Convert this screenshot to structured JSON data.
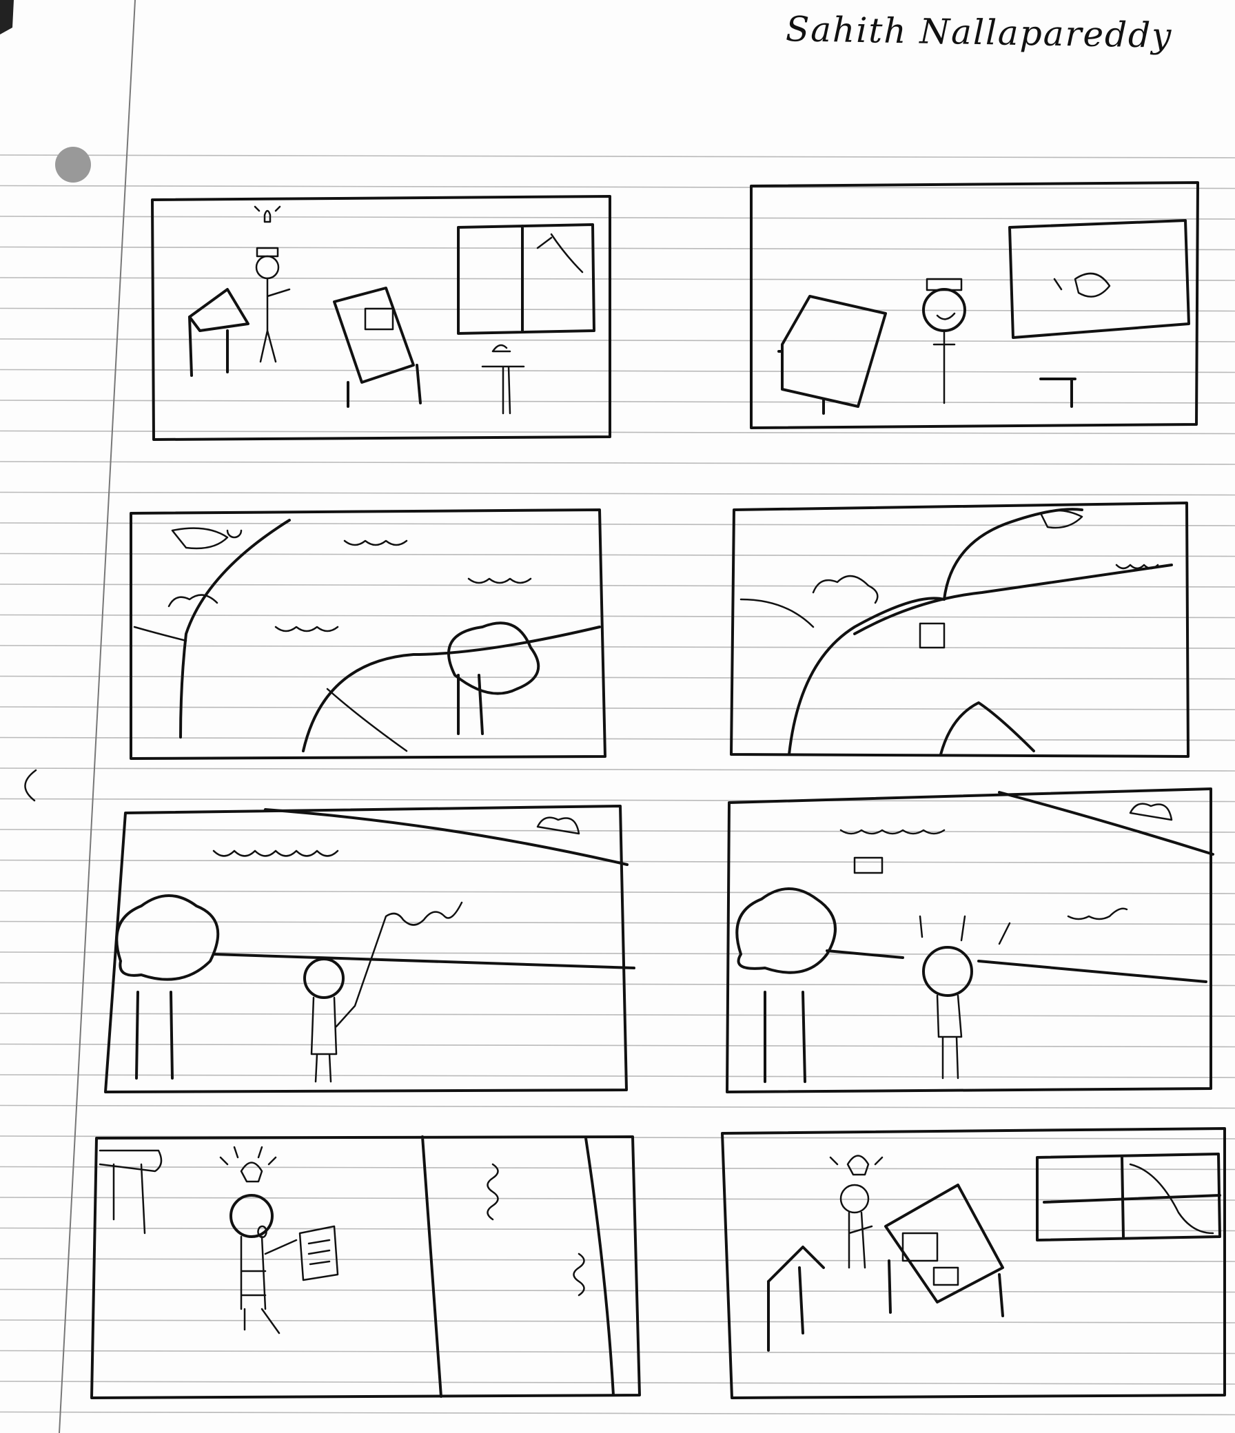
{
  "signature": "Sahith Nallapareddy",
  "colors": {
    "paper": "#fdfdfd",
    "ink": "#111111",
    "rule_line": "#b9b9b9"
  }
}
